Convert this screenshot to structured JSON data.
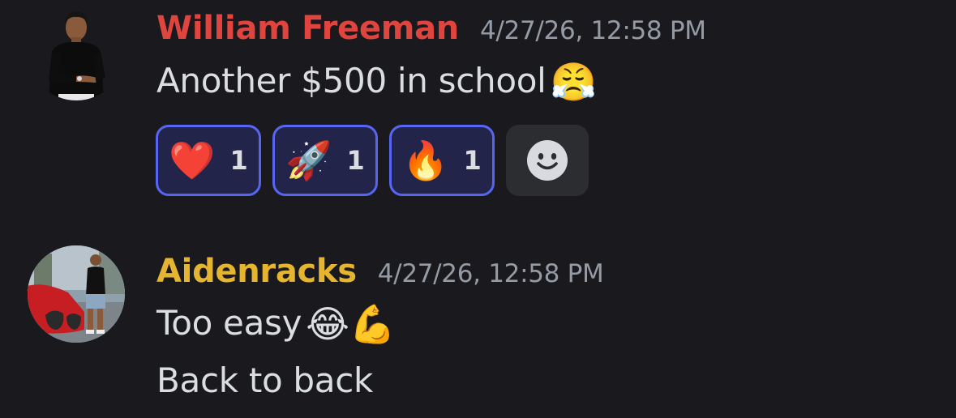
{
  "messages": [
    {
      "author": "William Freeman",
      "author_color": "#e0443e",
      "timestamp": "4/27/26, 12:58 PM",
      "lines": [
        {
          "text": "Another $500 in school",
          "emoji": "😤"
        }
      ],
      "reactions": [
        {
          "emoji": "❤️",
          "count": "1",
          "icon": "heart-icon"
        },
        {
          "emoji": "🚀",
          "count": "1",
          "icon": "rocket-icon"
        },
        {
          "emoji": "🔥",
          "count": "1",
          "icon": "fire-icon"
        }
      ],
      "add_reaction_icon": "smiley-add-reaction-icon"
    },
    {
      "author": "Aidenracks",
      "author_color": "#e6b530",
      "timestamp": "4/27/26, 12:58 PM",
      "lines": [
        {
          "text": "Too easy",
          "emoji": "😂💪"
        },
        {
          "text": "Back to back",
          "emoji": ""
        }
      ]
    }
  ],
  "colors": {
    "background": "#1a1a1e",
    "reaction_border": "#5865f2",
    "reaction_bg": "#232449",
    "timestamp": "#949ba4",
    "message_text": "#dbdee1"
  }
}
